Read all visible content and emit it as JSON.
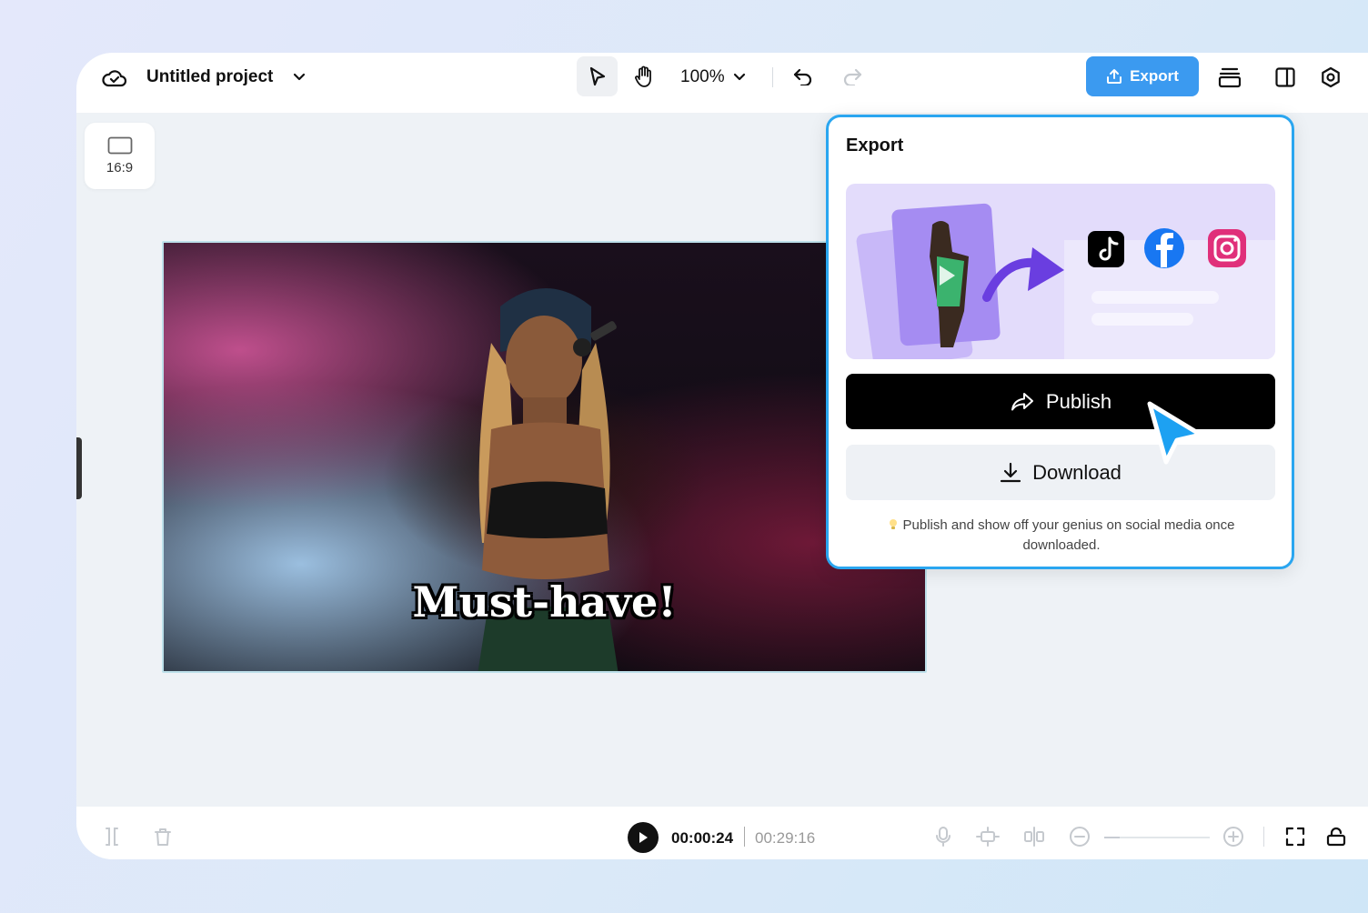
{
  "header": {
    "project_title": "Untitled project",
    "zoom": "100%",
    "export_label": "Export"
  },
  "aspect": {
    "label": "16:9"
  },
  "video": {
    "caption": "Must-have!"
  },
  "export_panel": {
    "title": "Export",
    "publish_label": "Publish",
    "download_label": "Download",
    "hint": "Publish and show off your genius on social media once downloaded.",
    "platforms": [
      "tiktok-icon",
      "facebook-icon",
      "instagram-icon"
    ]
  },
  "timeline": {
    "current_time": "00:00:24",
    "total_time": "00:29:16",
    "zoom_level": 0.15
  },
  "colors": {
    "accent": "#3b9af0",
    "panel_border": "#2aa6f0",
    "publish_bg": "#000000"
  }
}
